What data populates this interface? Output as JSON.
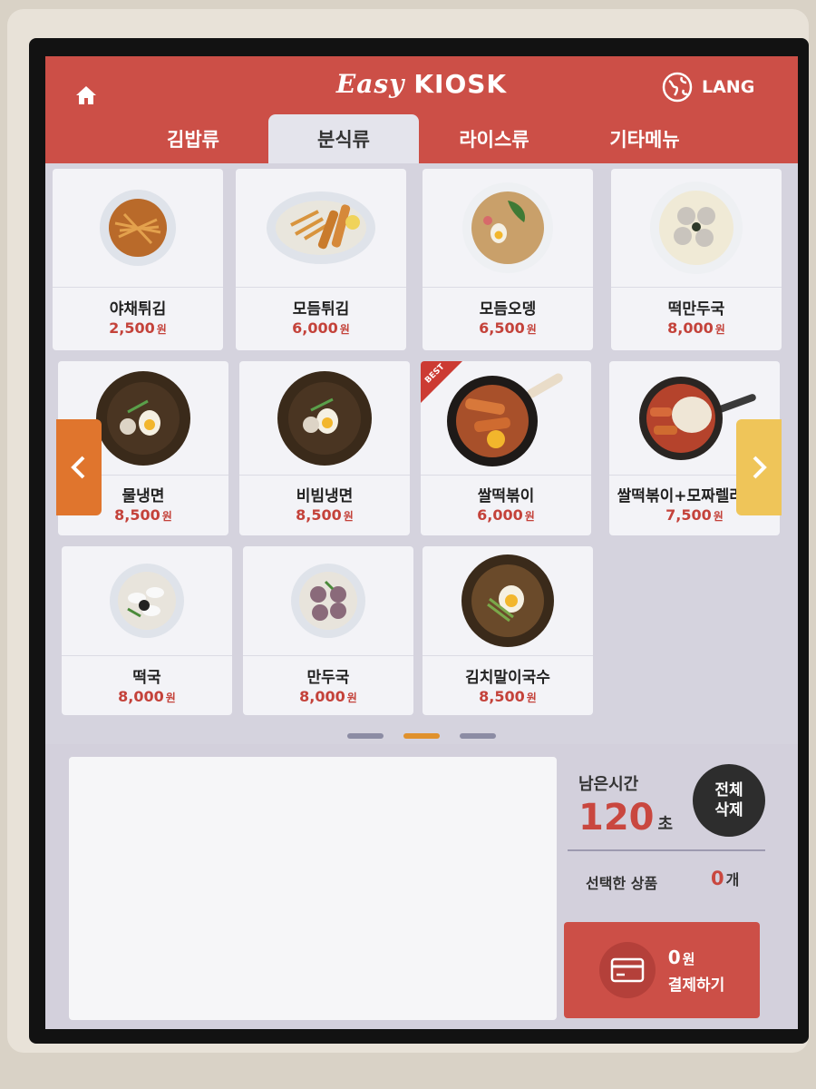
{
  "header": {
    "brand_prefix": "Easy",
    "brand_suffix": "KIOSK",
    "lang_label": "LANG",
    "home_icon": "home-icon",
    "lang_icon": "globe-icon"
  },
  "tabs": [
    {
      "label": "김밥류",
      "active": false
    },
    {
      "label": "분식류",
      "active": true
    },
    {
      "label": "라이스류",
      "active": false
    },
    {
      "label": "기타메뉴",
      "active": false
    }
  ],
  "menu": {
    "currency": "원",
    "items": [
      {
        "name": "야채튀김",
        "price": "2,500",
        "badge": ""
      },
      {
        "name": "모듬튀김",
        "price": "6,000",
        "badge": ""
      },
      {
        "name": "모듬오뎅",
        "price": "6,500",
        "badge": ""
      },
      {
        "name": "떡만두국",
        "price": "8,000",
        "badge": ""
      },
      {
        "name": "물냉면",
        "price": "8,500",
        "badge": ""
      },
      {
        "name": "비빔냉면",
        "price": "8,500",
        "badge": ""
      },
      {
        "name": "쌀떡볶이",
        "price": "6,000",
        "badge": "BEST"
      },
      {
        "name": "쌀떡볶이+모짜렐라치즈",
        "price": "7,500",
        "badge": ""
      },
      {
        "name": "떡국",
        "price": "8,000",
        "badge": ""
      },
      {
        "name": "만두국",
        "price": "8,000",
        "badge": ""
      },
      {
        "name": "김치말이국수",
        "price": "8,500",
        "badge": ""
      }
    ]
  },
  "pagination": {
    "prev_icon": "chevron-left-icon",
    "next_icon": "chevron-right-icon",
    "pages": 3,
    "current_page": 2
  },
  "order": {
    "timer_label": "남은시간",
    "timer_value": "120",
    "timer_unit": "초",
    "clear_line1": "전체",
    "clear_line2": "삭제",
    "selected_label": "선택한 상품",
    "selected_count": "0",
    "selected_unit": "개",
    "pay_amount": "0",
    "pay_currency": "원",
    "pay_label": "결제하기",
    "pay_icon": "credit-card-icon"
  },
  "colors": {
    "primary_red": "#cc4f47",
    "price_red": "#c4423a",
    "prev_orange": "#e0752d",
    "next_yellow": "#efc559"
  }
}
